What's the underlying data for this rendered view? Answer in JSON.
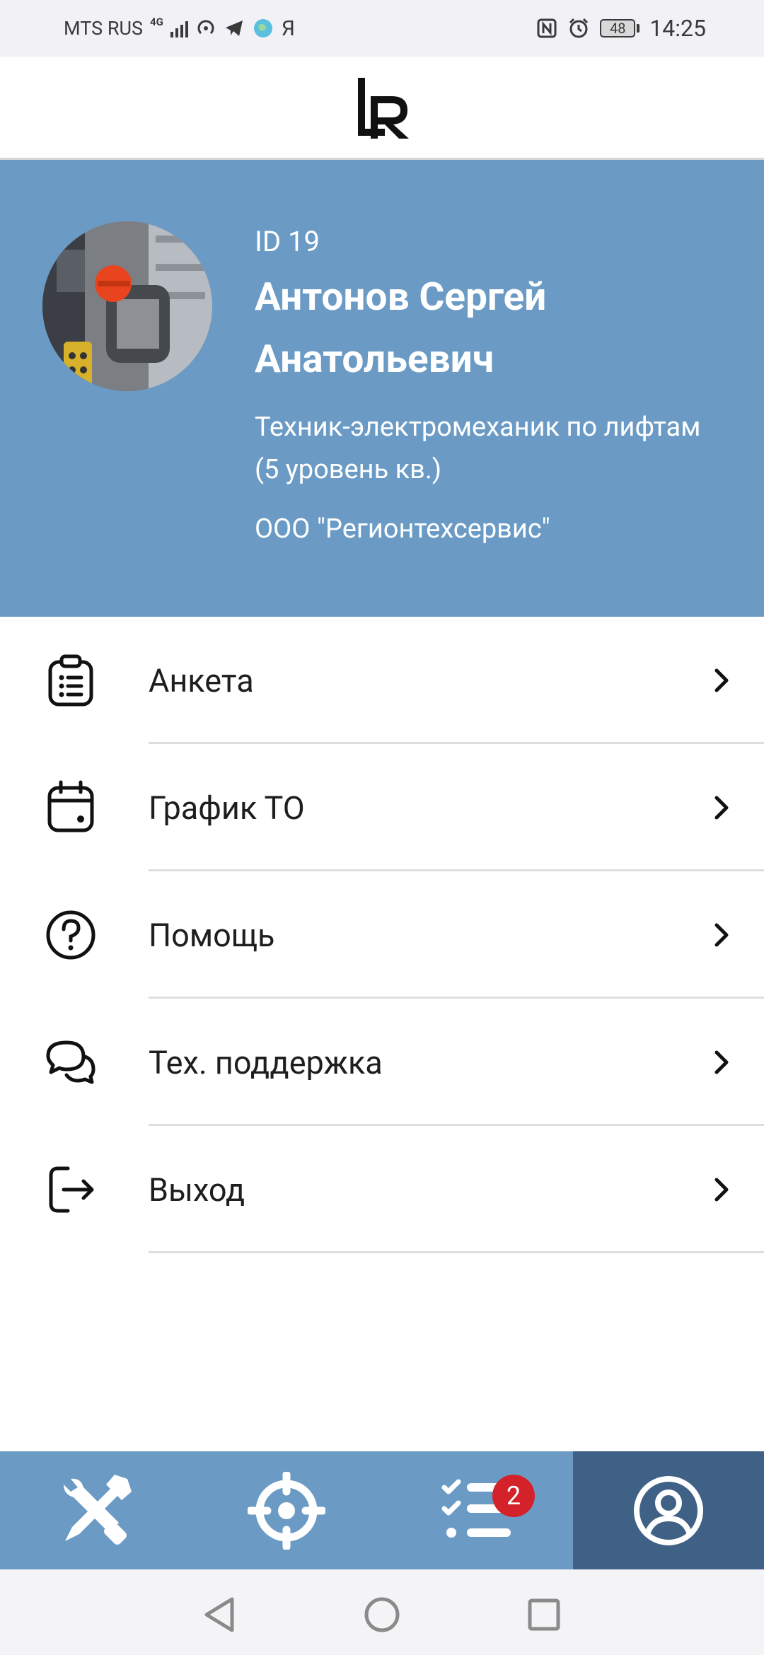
{
  "status_bar": {
    "carrier": "MTS RUS",
    "network": "4G",
    "ya": "Я",
    "battery": "48",
    "time": "14:25"
  },
  "header": {
    "logo": "LR"
  },
  "profile": {
    "id": "ID 19",
    "name": "Антонов Сергей Анатольевич",
    "position": "Техник-электромеханик по лифтам (5 уровень кв.)",
    "organization": "ООО \"Регионтехсервис\""
  },
  "menu": {
    "items": [
      {
        "label": "Анкета",
        "icon": "clipboard-list-icon"
      },
      {
        "label": "График ТО",
        "icon": "calendar-icon"
      },
      {
        "label": "Помощь",
        "icon": "help-circle-icon"
      },
      {
        "label": "Тех. поддержка",
        "icon": "chat-bubbles-icon"
      },
      {
        "label": "Выход",
        "icon": "logout-icon"
      }
    ]
  },
  "bottom_nav": {
    "tabs": [
      {
        "name": "tools",
        "icon": "wrench-screwdriver-icon",
        "active": false
      },
      {
        "name": "location",
        "icon": "crosshair-icon",
        "active": false
      },
      {
        "name": "tasks",
        "icon": "checklist-icon",
        "active": false,
        "badge": "2"
      },
      {
        "name": "profile",
        "icon": "user-circle-icon",
        "active": true
      }
    ]
  },
  "colors": {
    "primary": "#6b9bc5",
    "active_tab": "#3f6185",
    "badge": "#d3222a"
  }
}
